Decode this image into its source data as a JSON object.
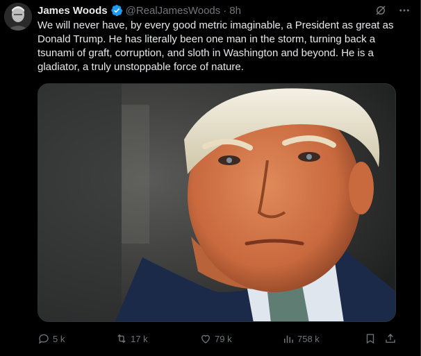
{
  "author": {
    "name": "James Woods",
    "handle": "@RealJamesWoods",
    "separator": "·",
    "time": "8h",
    "verified_icon": "verified-badge-icon",
    "verified_color": "#1d9bf0"
  },
  "tweet": {
    "text": "We will never have, by every good metric imaginable, a President as great as Donald Trump. He has literally been one man in the storm, turning back a tsunami of graft, corruption, and sloth in Washington and beyond. He is a gladiator, a truly unstoppable force of nature."
  },
  "media": {
    "type": "photo",
    "subject": "close-up portrait photo"
  },
  "actions": {
    "replies": "5 k",
    "reposts": "17 k",
    "likes": "79 k",
    "views": "758 k"
  },
  "colors": {
    "background": "#000000",
    "text_primary": "#e7e9ea",
    "text_secondary": "#71767b",
    "border": "#2f3336",
    "accent": "#1d9bf0"
  }
}
